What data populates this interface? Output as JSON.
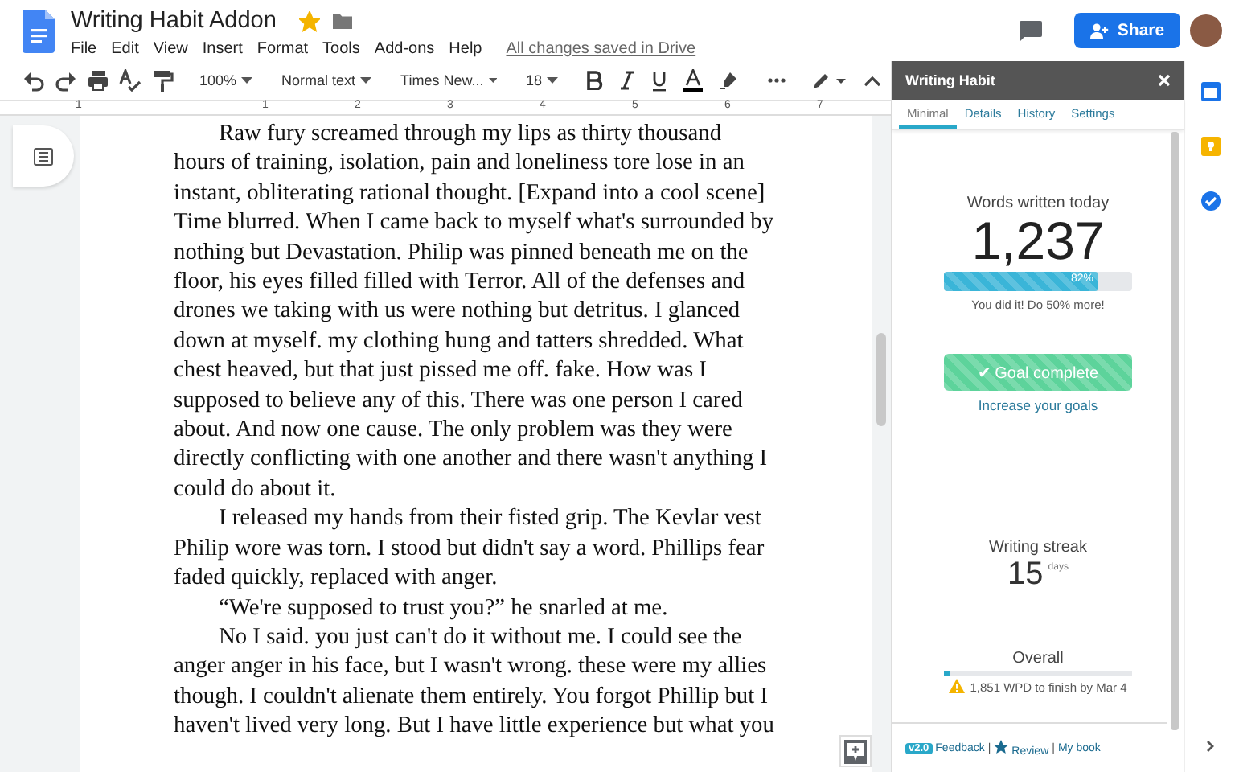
{
  "header": {
    "title": "Writing Habit Addon",
    "starred": true,
    "menu": [
      "File",
      "Edit",
      "View",
      "Insert",
      "Format",
      "Tools",
      "Add-ons",
      "Help"
    ],
    "save_status": "All changes saved in Drive",
    "share_button": "Share"
  },
  "toolbar": {
    "zoom": "100%",
    "style": "Normal text",
    "font": "Times New...",
    "size": "18"
  },
  "ruler": {
    "labels": [
      "1",
      "1",
      "2",
      "3",
      "4",
      "5",
      "6",
      "7"
    ]
  },
  "document": {
    "paragraphs": [
      {
        "lines": [
          "Raw fury screamed through my lips as thirty thousand",
          "hours of training, isolation, pain and loneliness tore lose in an",
          "instant, obliterating rational thought. [Expand into a cool scene]",
          "Time blurred. When I came back to myself what's surrounded by",
          "nothing but Devastation. Philip was pinned beneath me on the",
          "floor, his eyes filled filled with Terror. All of the defenses and",
          "drones we taking with us were nothing but detritus. I glanced",
          "down at myself. my clothing hung and tatters shredded. What",
          "chest heaved, but that just pissed me off. fake. How was I",
          "supposed to believe any of this. There was one person I cared",
          "about. And now one cause. The only problem was they were",
          "directly conflicting with one another and there wasn't anything I",
          "could do about it."
        ]
      },
      {
        "lines": [
          "I released my hands from their fisted grip. The Kevlar vest",
          "Philip wore was torn. I stood but didn't say a word. Phillips fear",
          "faded quickly, replaced with anger."
        ]
      },
      {
        "lines": [
          "“We're supposed to trust you?” he snarled at me."
        ]
      },
      {
        "lines": [
          "No I said. you just can't do it without me.  I could see the",
          "anger anger in his face, but I wasn't wrong. these were my allies",
          "though. I couldn't alienate them entirely. You forgot Phillip but I",
          "haven't lived very long. But I have little experience but what you"
        ]
      }
    ]
  },
  "sidebar": {
    "title": "Writing Habit",
    "tabs": [
      {
        "label": "Minimal",
        "selected": true
      },
      {
        "label": "Details",
        "selected": false
      },
      {
        "label": "History",
        "selected": false
      },
      {
        "label": "Settings",
        "selected": false
      }
    ],
    "words_label": "Words written today",
    "words_count": "1,237",
    "daily_progress": {
      "level": 0.82,
      "label": "82%"
    },
    "daily_message": "You did it! Do 50% more!",
    "goal_button": "✔ Goal complete",
    "goal_link": "Increase your goals",
    "streak_label": "Writing streak",
    "streak_count": "15",
    "streak_unit": "days",
    "overall_label": "Overall",
    "overall_progress": {
      "level": 0.03
    },
    "overall_warning": "1,851 WPD to finish by Mar 4",
    "footer": {
      "version": "v2.0",
      "items": [
        {
          "kind": "link",
          "text": "Feedback"
        },
        {
          "kind": "separator",
          "text": "|"
        },
        {
          "kind": "starlink",
          "text": "Review"
        },
        {
          "kind": "separator",
          "text": "|"
        },
        {
          "kind": "link",
          "text": "My book"
        }
      ]
    }
  }
}
